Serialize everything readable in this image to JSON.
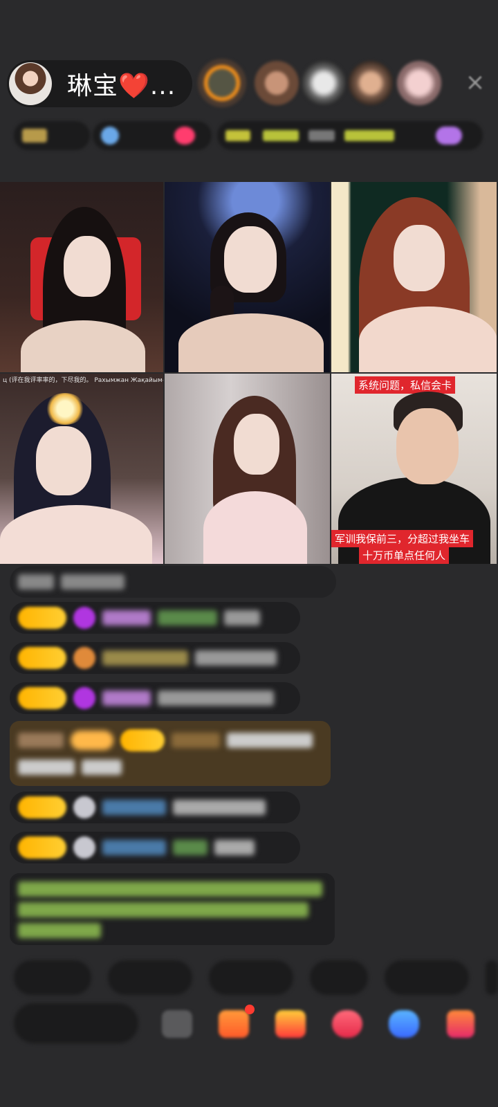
{
  "header": {
    "host_name": "琳宝❤️...",
    "close_label": "×"
  },
  "grid": {
    "tile4_caption": "ц (评在我评率率的，下尽我的。 Рахымжан Жақайым-Сен",
    "tile6_top_banner": "系统问题，私信会卡",
    "tile6_bottom_banner_line1": "军训我保前三，分超过我坐车",
    "tile6_bottom_banner_line2": "十万币单点任何人"
  },
  "bottom": {
    "chips": [
      "",
      "",
      "",
      "",
      ""
    ],
    "input_placeholder": ""
  },
  "colors": {
    "background": "#2a2a2c",
    "pill": "#1b1b1c",
    "banner_red": "#e0262d",
    "level_gold": "#ffb400"
  }
}
